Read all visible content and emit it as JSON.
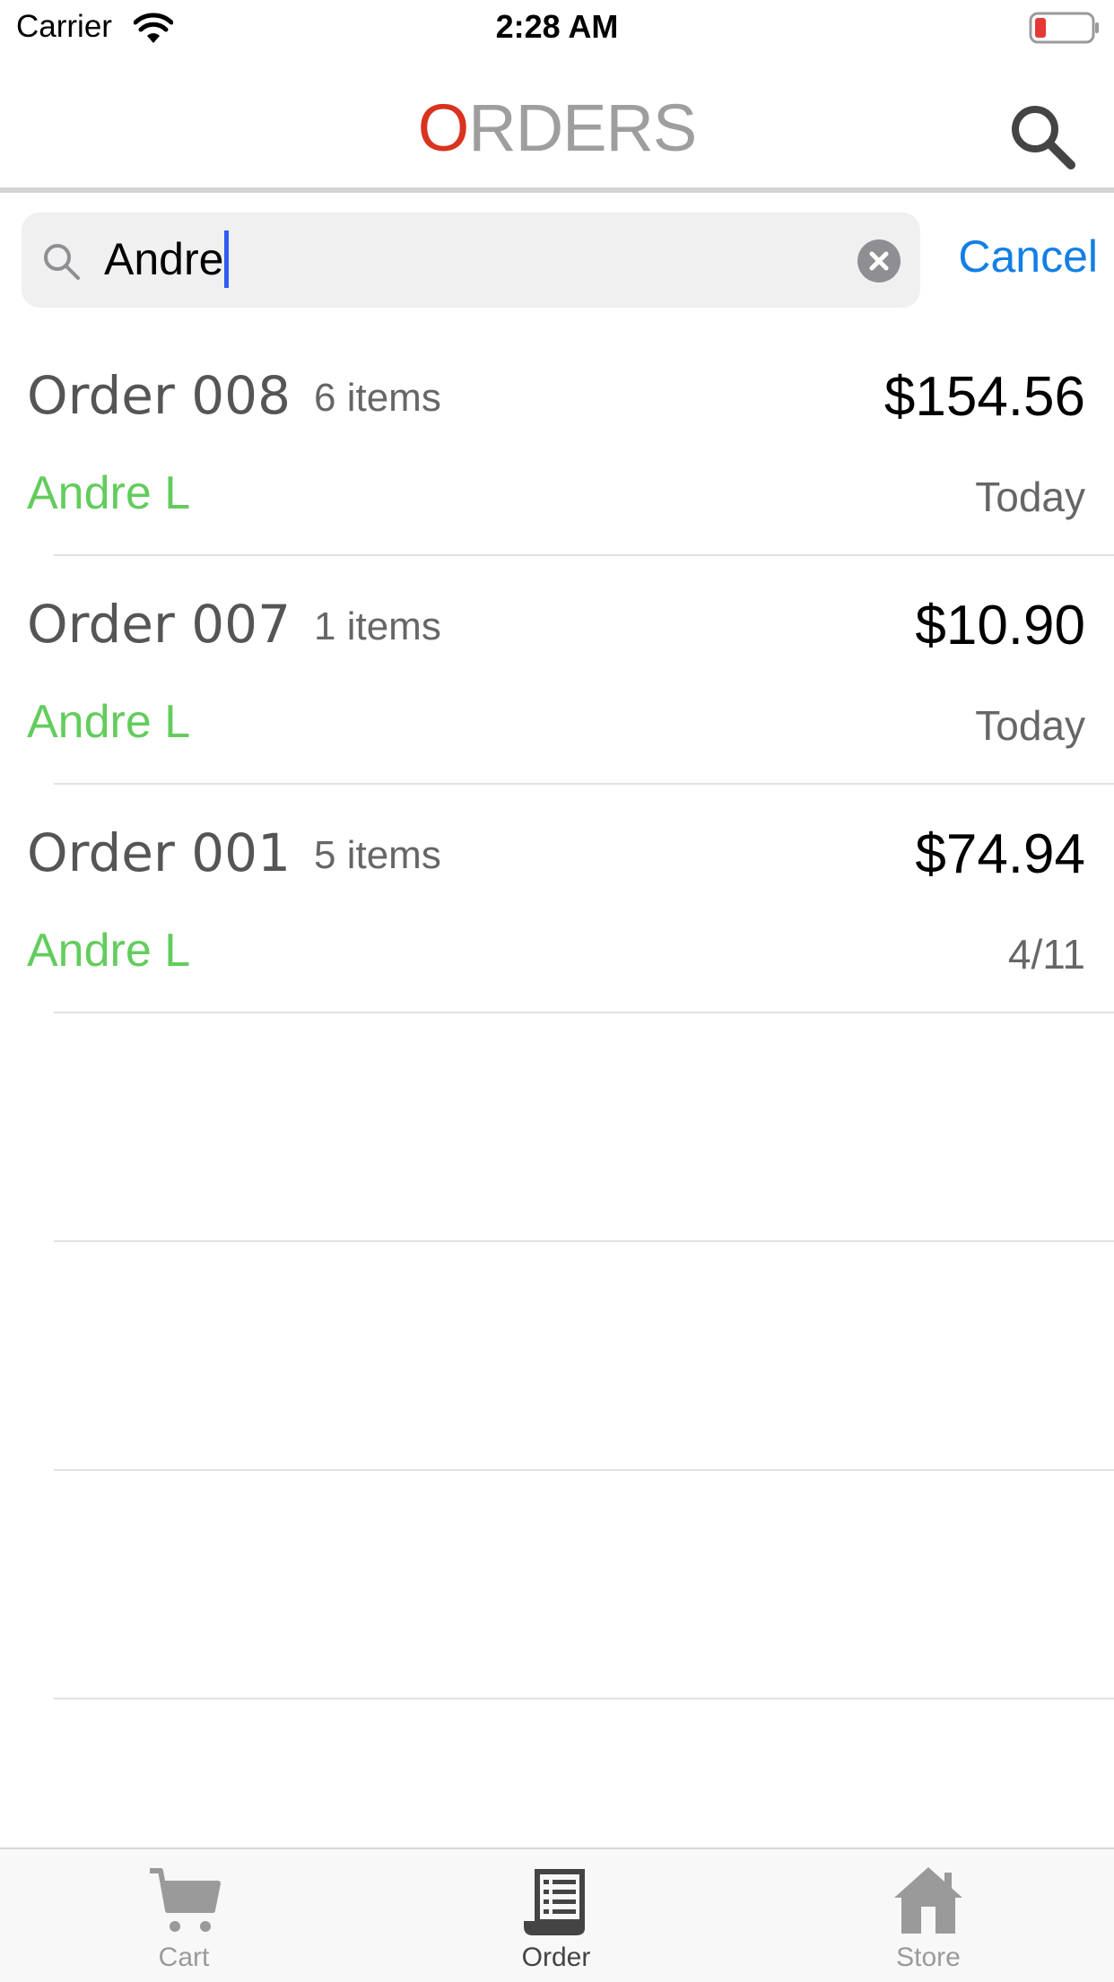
{
  "status_bar": {
    "carrier": "Carrier",
    "time": "2:28 AM",
    "battery_color": "#e53935"
  },
  "nav": {
    "title_first_letter": "O",
    "title_rest": "RDERS",
    "accent_color": "#d9331f"
  },
  "search": {
    "value": "Andre",
    "cancel_label": "Cancel"
  },
  "orders": [
    {
      "title": "Order 008",
      "items": "6 items",
      "total": "$154.56",
      "customer": "Andre L",
      "date": "Today"
    },
    {
      "title": "Order 007",
      "items": "1 items",
      "total": "$10.90",
      "customer": "Andre L",
      "date": "Today"
    },
    {
      "title": "Order 001",
      "items": "5 items",
      "total": "$74.94",
      "customer": "Andre L",
      "date": "4/11"
    }
  ],
  "tabs": [
    {
      "label": "Cart",
      "icon": "cart-icon",
      "active": false
    },
    {
      "label": "Order",
      "icon": "receipt-icon",
      "active": true
    },
    {
      "label": "Store",
      "icon": "store-icon",
      "active": false
    }
  ],
  "colors": {
    "customer_green": "#63cc5d",
    "link_blue": "#137fe6"
  }
}
